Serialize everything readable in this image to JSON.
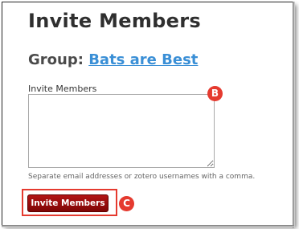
{
  "page": {
    "title": "Invite Members"
  },
  "group": {
    "prefix": "Group:",
    "name": "Bats are Best"
  },
  "form": {
    "field_label": "Invite Members",
    "textarea_value": "",
    "hint": "Separate email addresses or zotero usernames with a comma.",
    "submit_label": "Invite Members"
  },
  "callouts": {
    "b": "B",
    "c": "C"
  },
  "colors": {
    "link": "#3a8fd6",
    "button": "#9a0d0d",
    "callout": "#e53a2f"
  }
}
